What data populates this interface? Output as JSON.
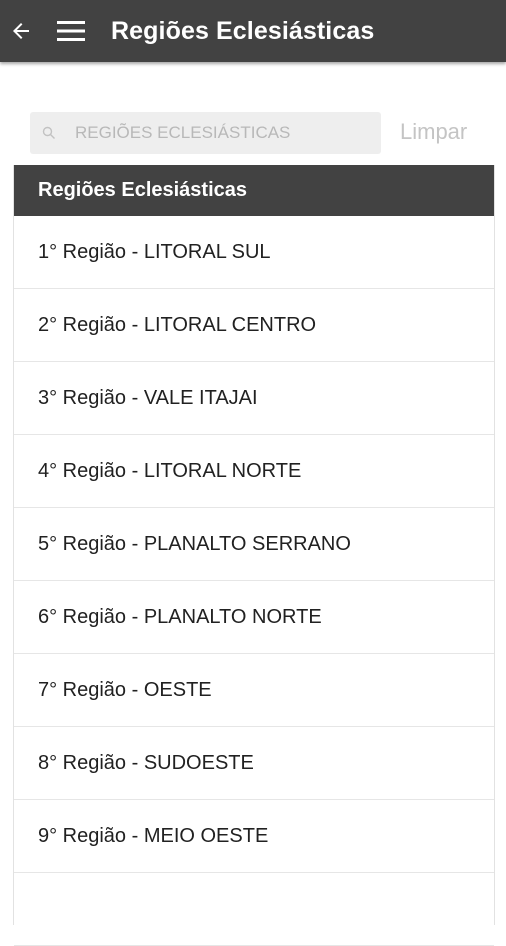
{
  "appbar": {
    "title": "Regiões Eclesiásticas",
    "back_icon": "arrow-left-icon",
    "menu_icon": "hamburger-menu-icon",
    "background": "#424242"
  },
  "search": {
    "placeholder": "REGIÕES ECLESIÁSTICAS",
    "value": "",
    "icon": "search-icon",
    "clear_label": "Limpar"
  },
  "list": {
    "header": "Regiões Eclesiásticas",
    "items": [
      {
        "label": "1° Região - LITORAL SUL"
      },
      {
        "label": "2° Região - LITORAL CENTRO"
      },
      {
        "label": "3° Região - VALE ITAJAI"
      },
      {
        "label": "4° Região - LITORAL NORTE"
      },
      {
        "label": "5° Região - PLANALTO SERRANO"
      },
      {
        "label": "6° Região - PLANALTO NORTE"
      },
      {
        "label": "7° Região - OESTE"
      },
      {
        "label": "8° Região - SUDOESTE"
      },
      {
        "label": "9° Região - MEIO OESTE"
      },
      {
        "label": ""
      }
    ]
  }
}
